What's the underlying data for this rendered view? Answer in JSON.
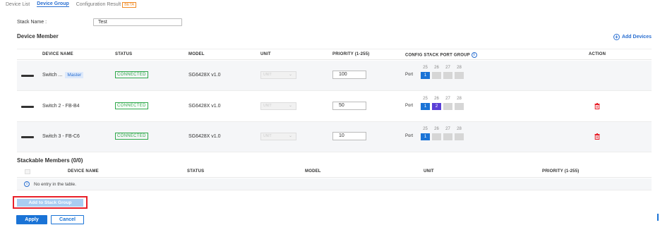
{
  "tabs": [
    {
      "label": "Device List"
    },
    {
      "label": "Device Group"
    },
    {
      "label": "Configuration Result"
    }
  ],
  "beta_label": "BETA",
  "stack_name": {
    "label": "Stack Name :",
    "value": "Test"
  },
  "device_member": {
    "title": "Device Member",
    "add_label": "Add Devices",
    "columns": [
      "DEVICE NAME",
      "STATUS",
      "MODEL",
      "UNIT",
      "PRIORITY (1-255)",
      "CONFIG STACK PORT GROUP",
      "ACTION"
    ],
    "rows": [
      {
        "name": "Switch ...",
        "badge": "Master",
        "status": "CONNECTED",
        "model": "SG6428X v1.0",
        "unit": "UNIT",
        "priority": "100",
        "port_label": "Port",
        "ports": [
          {
            "num": "25",
            "value": "1",
            "color": "#1a73d6"
          },
          {
            "num": "26",
            "value": "",
            "color": "#d6d6d6"
          },
          {
            "num": "27",
            "value": "",
            "color": "#d6d6d6"
          },
          {
            "num": "28",
            "value": "",
            "color": "#d6d6d6"
          }
        ]
      },
      {
        "name": "Switch 2 - FB-B4",
        "status": "CONNECTED",
        "model": "SG6428X v1.0",
        "unit": "UNIT",
        "priority": "50",
        "port_label": "Port",
        "ports": [
          {
            "num": "25",
            "value": "1",
            "color": "#1a73d6"
          },
          {
            "num": "26",
            "value": "2",
            "color": "#5a3fd6"
          },
          {
            "num": "27",
            "value": "",
            "color": "#d6d6d6"
          },
          {
            "num": "28",
            "value": "",
            "color": "#d6d6d6"
          }
        ]
      },
      {
        "name": "Switch 3 - FB-C6",
        "status": "CONNECTED",
        "model": "SG6428X v1.0",
        "unit": "UNIT",
        "priority": "10",
        "port_label": "Port",
        "ports": [
          {
            "num": "25",
            "value": "1",
            "color": "#1a73d6"
          },
          {
            "num": "26",
            "value": "",
            "color": "#d6d6d6"
          },
          {
            "num": "27",
            "value": "",
            "color": "#d6d6d6"
          },
          {
            "num": "28",
            "value": "",
            "color": "#d6d6d6"
          }
        ]
      }
    ]
  },
  "stackable_members": {
    "title": "Stackable Members (0/0)",
    "columns": [
      "DEVICE NAME",
      "STATUS",
      "MODEL",
      "UNIT",
      "PRIORITY (1-255)"
    ],
    "empty_text": "No entry in the table."
  },
  "buttons": {
    "add_to_stack": "Add to Stack Group",
    "apply": "Apply",
    "cancel": "Cancel"
  },
  "colors": {
    "accent": "#1a73d6",
    "connected": "#2ea84a",
    "delete": "#e8202a",
    "highlight": "#e8202a"
  }
}
